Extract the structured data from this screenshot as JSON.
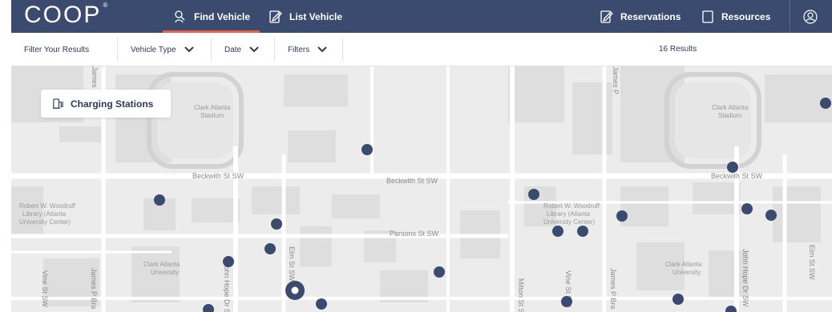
{
  "brand": {
    "logo_text": "COOP",
    "reg_mark": "®"
  },
  "nav": {
    "find_vehicle": "Find Vehicle",
    "list_vehicle": "List Vehicle",
    "reservations": "Reservations",
    "resources": "Resources"
  },
  "filters": {
    "filter_label": "Filter Your Results",
    "vehicle_type": "Vehicle Type",
    "date": "Date",
    "filters": "Filters",
    "results": "16 Results"
  },
  "map": {
    "charging_button": "Charging Stations",
    "streets": {
      "beckwith_1": "Beckwith St SW",
      "beckwith_2": "Beckwith St SW",
      "beckwith_3": "Beckwith St SW",
      "parsons": "Parsons St SW",
      "elm_1": "Elm St SW",
      "elm_2": "Elm St SW",
      "john_hope_1": "John Hope Dr SW",
      "john_hope_2": "John Hope Dr SW",
      "james_p_1": "James P Bra",
      "james_p_2": "James P Bra",
      "james_p_top_1": "James P",
      "james_p_top_2": "James P",
      "vine_1": "Vine St SW",
      "vine_2": "Vine St SW",
      "milton": "Milton St SW"
    },
    "pois": {
      "stadium_1": [
        "Clark Atlanta",
        "Stadium"
      ],
      "stadium_2": [
        "Clark Atlanta",
        "Stadium"
      ],
      "library_1": [
        "Robert W. Woodruff",
        "Library (Atlanta",
        "University Center)"
      ],
      "library_2": [
        "Robert W. Woodruff",
        "Library (Atlanta",
        "University Center)"
      ],
      "univ_1": [
        "Clark Atlanta",
        "University"
      ],
      "univ_2": [
        "Clark Atlanta",
        "University"
      ]
    },
    "marker_color": "#3b4b6f"
  },
  "colors": {
    "nav_bg": "#3b4b6f",
    "accent": "#e8604c",
    "map_bg": "#ececec"
  }
}
